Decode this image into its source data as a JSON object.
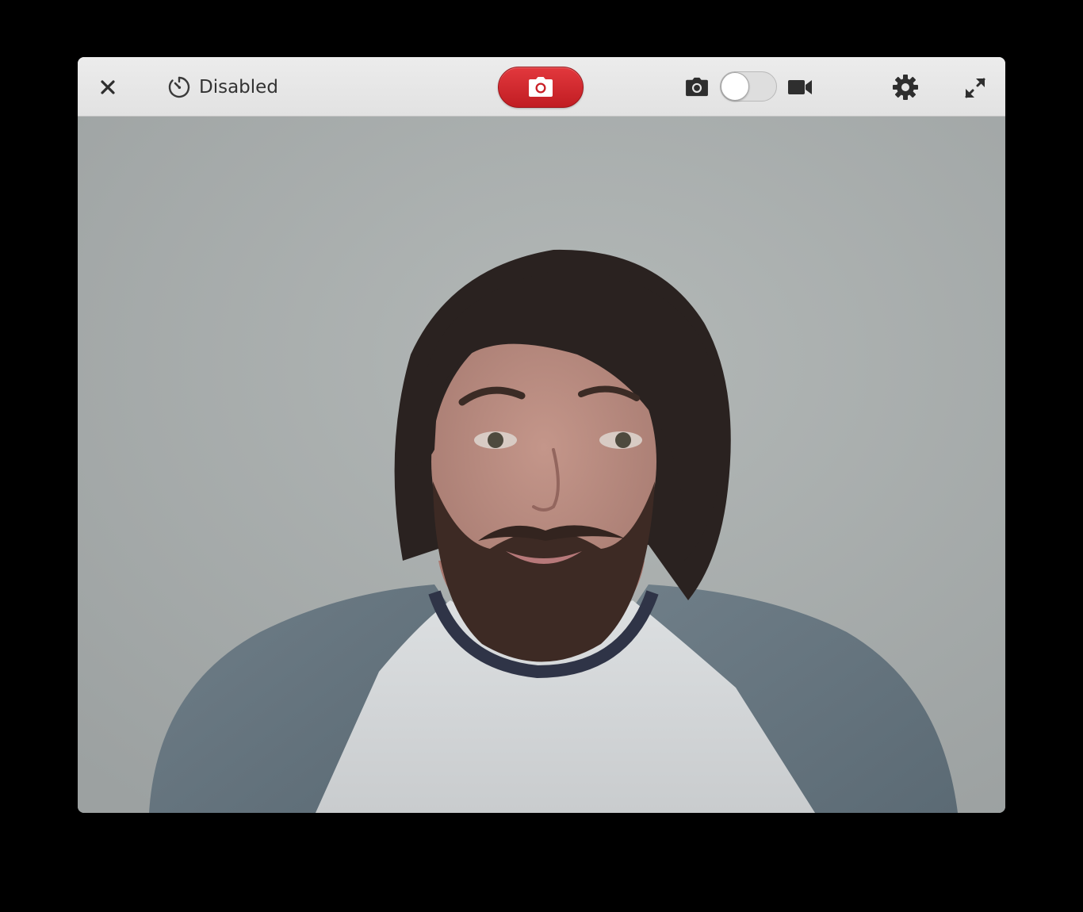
{
  "window": {
    "background": "#a7acac"
  },
  "headerbar": {
    "close_icon": "close-icon",
    "timer": {
      "icon": "timer-icon",
      "label": "Disabled"
    },
    "shutter": {
      "icon": "camera-icon",
      "color": "#d42a30"
    },
    "mode_switch": {
      "photo_icon": "camera-icon",
      "video_icon": "video-camera-icon",
      "mode": "photo"
    },
    "settings_icon": "gear-icon",
    "fullscreen_icon": "fullscreen-icon"
  },
  "viewfinder": {
    "content": "webcam-live-preview"
  }
}
